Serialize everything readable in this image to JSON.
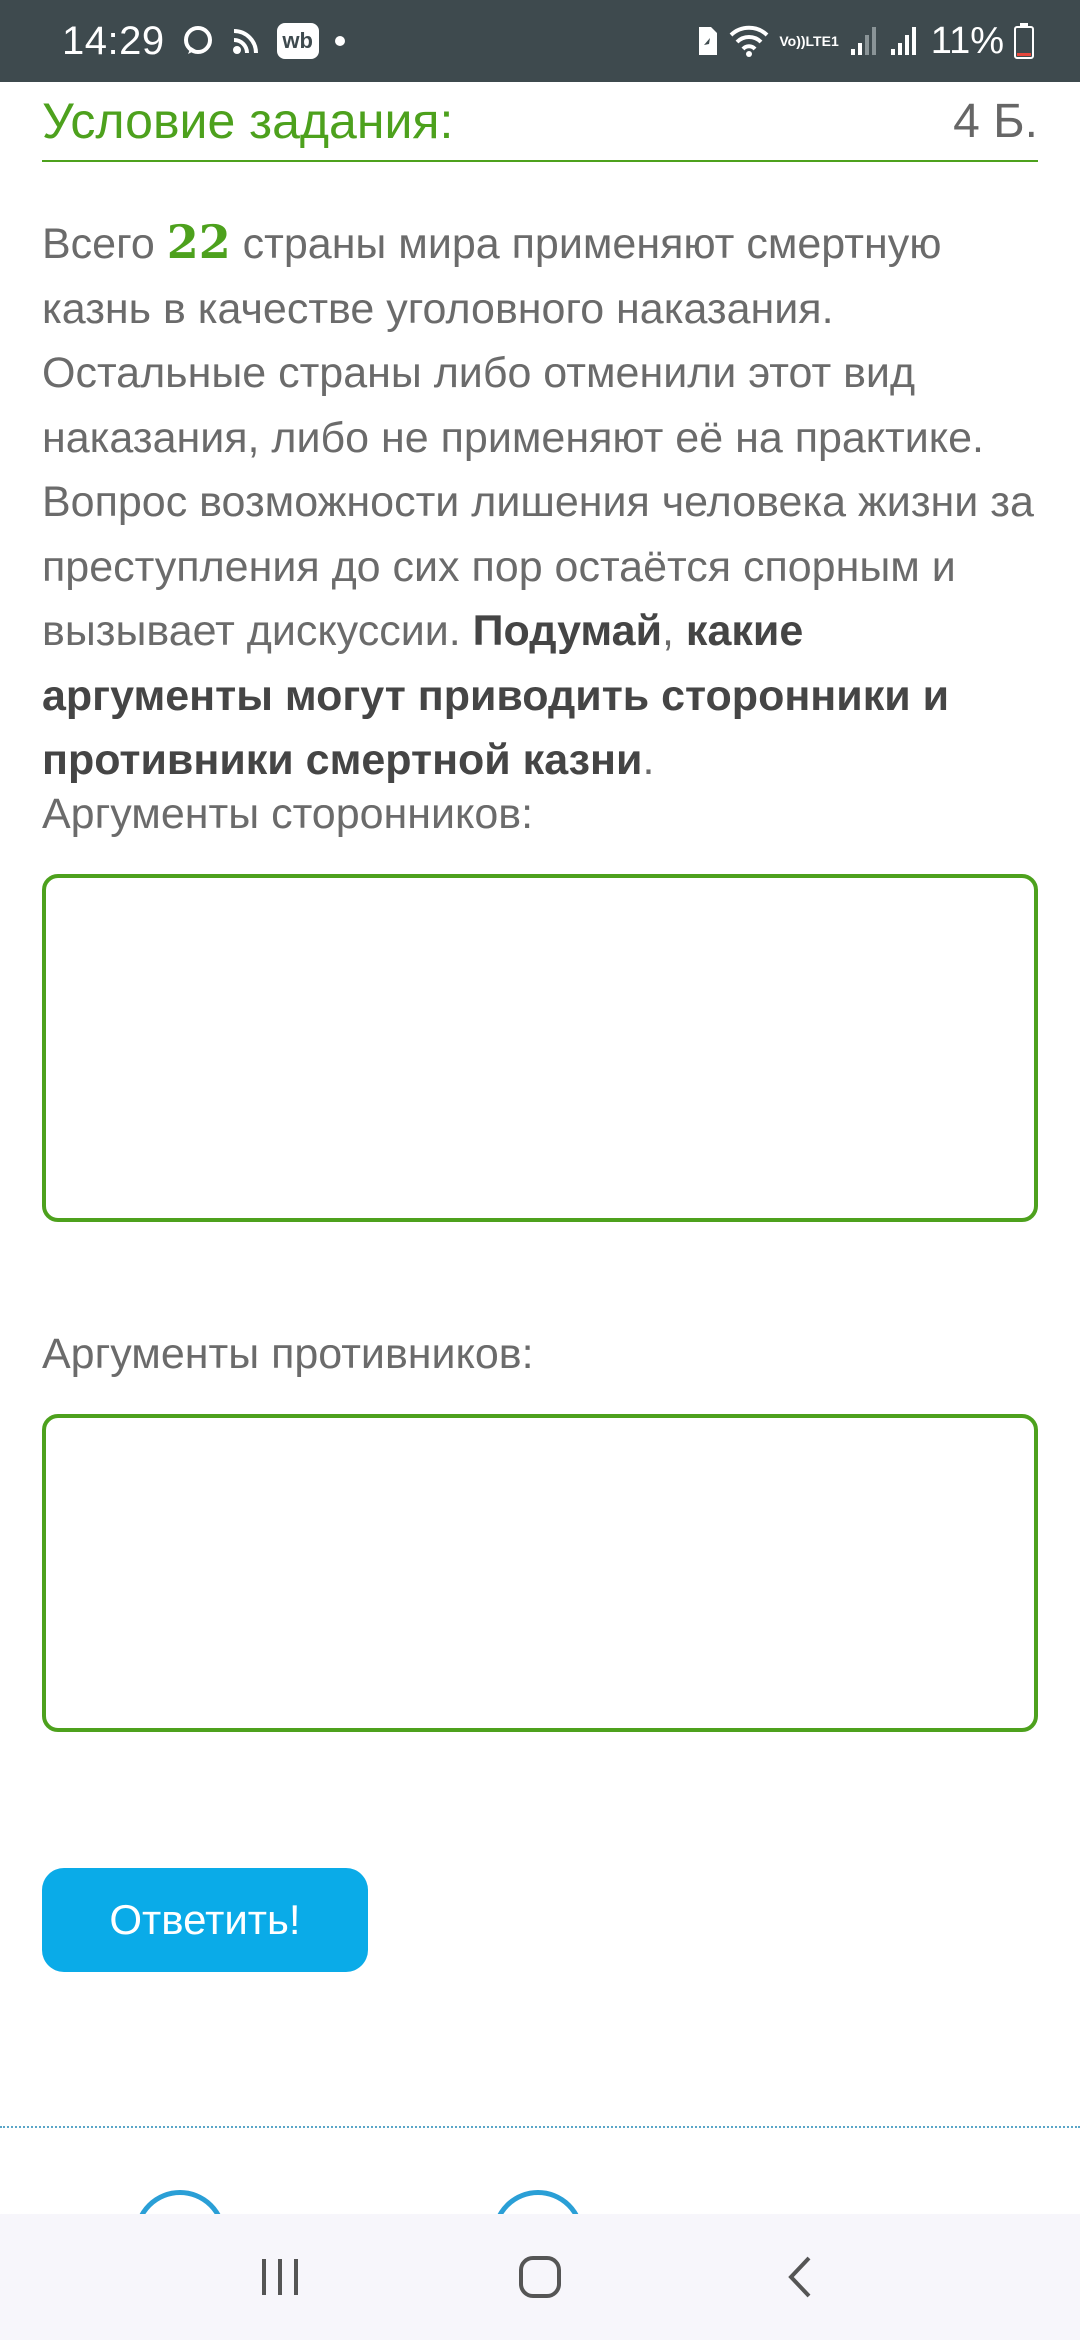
{
  "status_bar": {
    "time": "14:29",
    "left_icons": [
      "chat-bubble-icon",
      "rss-icon",
      "wb-app-icon",
      "notification-dot-icon"
    ],
    "wb_label": "wb",
    "lte_label_top": "Vo))",
    "lte_label_bottom": "LTE1",
    "battery_percent": "11%",
    "right_icons": [
      "sim-card-icon",
      "wifi-icon",
      "signal-icon",
      "signal-icon",
      "battery-icon"
    ]
  },
  "header": {
    "title": "Условие задания:",
    "points": "4 Б."
  },
  "task": {
    "text_before": "Всего ",
    "number": "22",
    "text_after": " страны мира применяют смертную казнь в качестве уголовного наказания. Остальные страны либо отменили этот вид наказания, либо не применяют её на практике. Вопрос возможности лишения человека жизни за преступления до сих пор остаётся спорным и вызывает дискуссии. ",
    "bold_a": "Подумай",
    "comma": ", ",
    "bold_b": "какие аргументы могут приводить сторонники и противники смертной казни",
    "period": "."
  },
  "fields": {
    "supporters_label": "Аргументы сторонников:",
    "supporters_value": "",
    "opponents_label": "Аргументы противников:",
    "opponents_value": ""
  },
  "submit_label": "Ответить!",
  "colors": {
    "accent_green": "#4da11d",
    "button_blue": "#0aabe8",
    "status_bar": "#3e4a4e"
  },
  "nav_bar": {
    "icons": [
      "recent-apps-icon",
      "home-icon",
      "back-icon"
    ]
  }
}
